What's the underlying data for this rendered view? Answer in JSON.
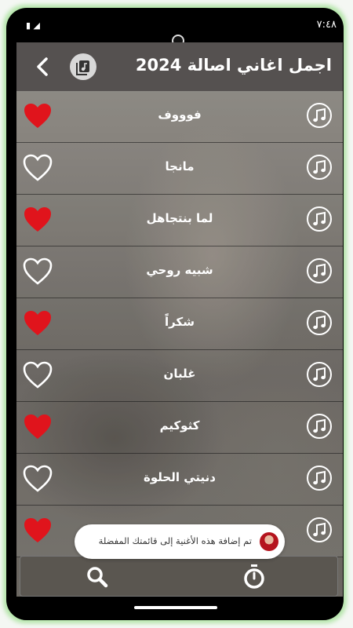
{
  "status": {
    "time": "٧:٤٨",
    "battery_icon": "battery-icon"
  },
  "header": {
    "title": "اجمل اغاني اصالة 2024",
    "back_icon": "chevron-left-icon",
    "library_icon": "music-library-icon"
  },
  "songs": [
    {
      "name": "فوووف",
      "favorite": true
    },
    {
      "name": "مانجا",
      "favorite": false
    },
    {
      "name": "لما بنتجاهل",
      "favorite": true
    },
    {
      "name": "شبيه روحي",
      "favorite": false
    },
    {
      "name": "شكراً",
      "favorite": true
    },
    {
      "name": "غلبان",
      "favorite": false
    },
    {
      "name": "كثوكيم",
      "favorite": true
    },
    {
      "name": "دنيتي الحلوة",
      "favorite": false
    },
    {
      "name": "",
      "favorite": true
    }
  ],
  "toast": {
    "message": "تم إضافة هذه الأغنية إلى قائمتك المفضلة"
  },
  "bottom": {
    "search_icon": "search-icon",
    "timer_icon": "stopwatch-icon"
  },
  "colors": {
    "heart_red": "#e0141c",
    "header_bg": "#555150",
    "frame_glow": "#7ed66c"
  }
}
